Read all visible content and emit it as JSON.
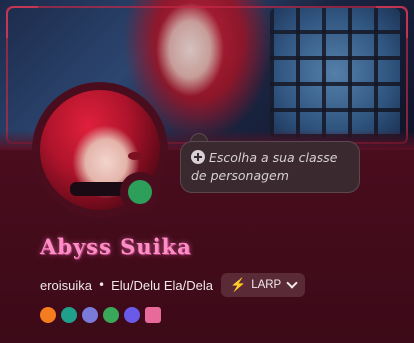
{
  "profile": {
    "display_name": "Abyss Suika",
    "username": "eroisuika",
    "separator": "•",
    "pronouns": "Elu/Delu Ela/Dela",
    "tag": {
      "label": "LARP",
      "icon": "bolt-icon"
    },
    "status": {
      "state": "online",
      "color": "#2e9e5b"
    },
    "custom_status_prompt": {
      "line1": "Escolha a sua classe",
      "line2": "de personagem",
      "icon": "plus-circle-icon"
    }
  },
  "badges": [
    {
      "name": "hypesquad-badge",
      "color": "#f57c1f"
    },
    {
      "name": "hashtag-badge",
      "color": "#1fa08a"
    },
    {
      "name": "gear-badge",
      "color": "#7a7ad8"
    },
    {
      "name": "leaf-badge",
      "color": "#3aa85a"
    },
    {
      "name": "quest-badge",
      "color": "#6a5ae8"
    },
    {
      "name": "gift-badge",
      "color": "#e86a9a"
    }
  ],
  "colors": {
    "accent_name": "#ff8ec6",
    "card_background": "#5a1024"
  }
}
